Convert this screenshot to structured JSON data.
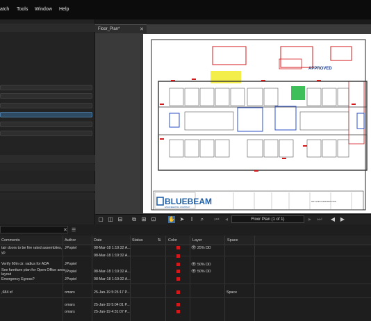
{
  "menu": {
    "items": [
      "atch",
      "Tools",
      "Window",
      "Help"
    ]
  },
  "tab": {
    "label": "Floor_Plan*",
    "close": "✕"
  },
  "sheet": {
    "brand": "BLUEBEAM",
    "approved_stamp": "APPROVED",
    "brand_sub": "ENGINEERING COMPANY",
    "stamp_text": "NOT FOR CONSTRUCTION"
  },
  "navigation": {
    "page_label": "Floor Plan (1 of 1)"
  },
  "markups": {
    "filter_close": "✕",
    "view_icon": "☰",
    "columns": {
      "comments": "Comments",
      "author": "Author",
      "date": "Date",
      "status": "Status",
      "color": "Color",
      "layer": "Layer",
      "space": "Space"
    },
    "rows": [
      {
        "comment": "tair doors to be fire rated assemblies,",
        "comment2": "yp",
        "author": "JPopiel",
        "date": "08-Mar-18 1:19:32 A...",
        "layer": "25% DD",
        "space": ""
      },
      {
        "comment": "Verify 60in cir. radius for ADA",
        "comment2": "",
        "author": "JPopiel",
        "date": "08-Mar-18 1:19:32 A...",
        "layer": "50% DD",
        "space": ""
      },
      {
        "comment": "See furniture plan for Open Office area",
        "comment2": "layout",
        "author": "JPopiel",
        "date": "08-Mar-18 1:19:32 A...",
        "layer": "50% DD",
        "space": ""
      },
      {
        "comment": "Emergency Egress?",
        "comment2": "",
        "author": "JPopiel",
        "date": "08-Mar-18 1:19:32 A...",
        "layer": "",
        "space": ""
      },
      {
        "comment": ",684 sf",
        "comment2": "",
        "author": "omars",
        "date": "25-Jan-19 5:25:17 P...",
        "layer": "",
        "space": "Space"
      },
      {
        "comment": "",
        "comment2": "",
        "author": "omars",
        "date": "25-Jan-19 5:04:01 P...",
        "layer": "",
        "space": ""
      },
      {
        "comment": "",
        "comment2": "",
        "author": "omars",
        "date": "25-Jan-19 4:31:07 P...",
        "layer": "",
        "space": ""
      }
    ]
  },
  "colors": {
    "markup_red": "#d4191c",
    "brand_blue": "#1f5fa6",
    "selection": "#2f4b63"
  }
}
